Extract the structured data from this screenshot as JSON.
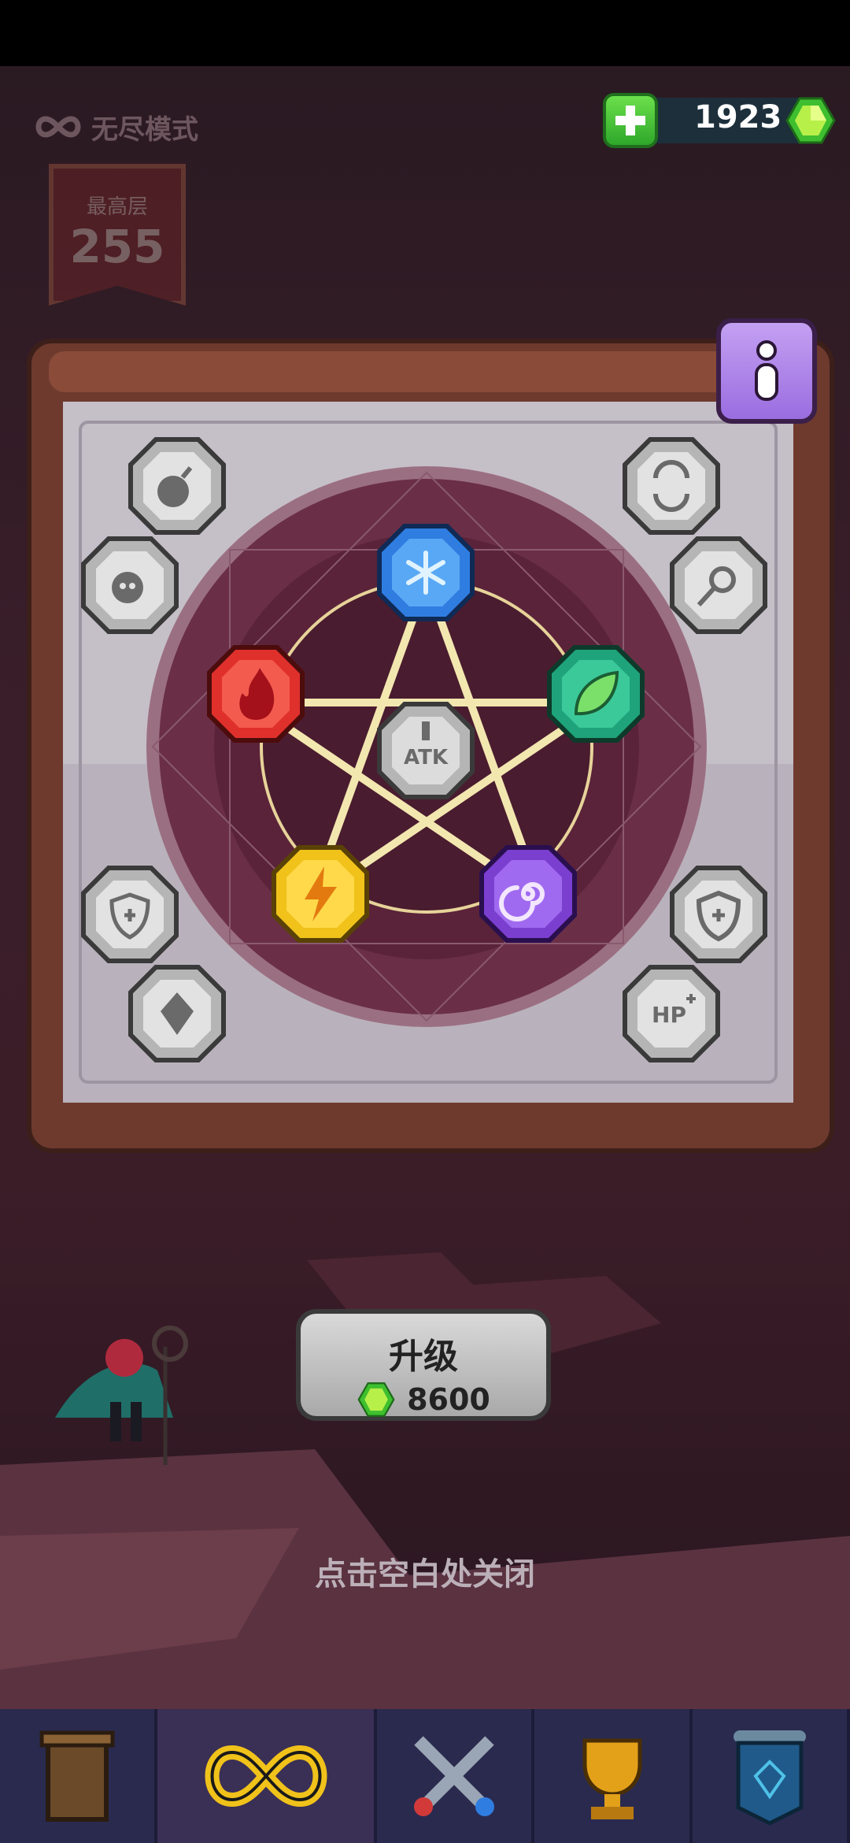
{
  "header": {
    "mode_label": "无尽模式",
    "highest_floor_label": "最高层",
    "highest_floor_value": "255"
  },
  "currency": {
    "amount": "1923",
    "icon": "green-gem-icon",
    "add_icon": "plus-icon"
  },
  "info_button": {
    "icon": "info-icon"
  },
  "pentagram": {
    "center": {
      "name": "attack-gem",
      "label": "ATK"
    },
    "elements": [
      "ice-gem",
      "nature-gem",
      "void-gem",
      "lightning-gem",
      "fire-gem"
    ]
  },
  "side_gems": {
    "left": [
      {
        "name": "bomb-gem"
      },
      {
        "name": "ghost-gem"
      },
      {
        "name": "shield-sword-gem"
      },
      {
        "name": "crystal-gem"
      }
    ],
    "right": [
      {
        "name": "swap-gem"
      },
      {
        "name": "comet-gem"
      },
      {
        "name": "shield-gem"
      },
      {
        "name": "hp-gem",
        "label": "HP"
      }
    ]
  },
  "upgrade": {
    "label": "升级",
    "cost": "8600",
    "cost_icon": "green-gem-icon"
  },
  "hint": "点击空白处关闭",
  "nav": {
    "tabs": [
      {
        "name": "wardrobe",
        "icon": "cabinet-icon"
      },
      {
        "name": "endless",
        "icon": "infinity-icon",
        "active": true
      },
      {
        "name": "battle",
        "icon": "crossed-swords-icon"
      },
      {
        "name": "ranking",
        "icon": "trophy-icon"
      },
      {
        "name": "map",
        "icon": "scroll-map-icon"
      }
    ]
  },
  "colors": {
    "ice": "#2f7de0",
    "nature": "#1fa37a",
    "void": "#7b3fd0",
    "lightning": "#f0c21a",
    "fire": "#e0302c",
    "silver": "#c9c9c9"
  }
}
